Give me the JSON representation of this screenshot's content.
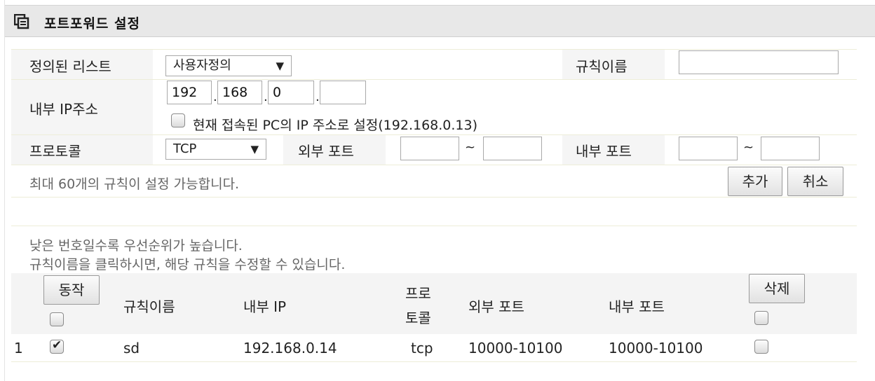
{
  "header": {
    "title": "포트포워드 설정"
  },
  "form": {
    "predefined_label": "정의된 리스트",
    "predefined_value": "사용자정의",
    "rule_name_label": "규칙이름",
    "rule_name_value": "",
    "internal_ip_label": "내부 IP주소",
    "ip_octets": [
      "192",
      "168",
      "0",
      ""
    ],
    "current_pc_checkbox_label": "현재 접속된 PC의 IP 주소로 설정(192.168.0.13)",
    "protocol_label": "프로토콜",
    "protocol_value": "TCP",
    "external_port_label": "외부 포트",
    "internal_port_label": "내부 포트",
    "range_sep": "~",
    "max_rules_note": "최대 60개의 규칙이 설정 가능합니다.",
    "add_button": "추가",
    "cancel_button": "취소"
  },
  "notes": {
    "line1": "낮은 번호일수록 우선순위가 높습니다.",
    "line2": "규칙이름을 클릭하시면, 해당 규칙을 수정할 수 있습니다."
  },
  "table": {
    "action_button": "동작",
    "col_rule_name": "규칙이름",
    "col_internal_ip": "내부 IP",
    "col_protocol_line1": "프로",
    "col_protocol_line2": "토콜",
    "col_external_port": "외부 포트",
    "col_internal_port": "내부 포트",
    "delete_button": "삭제",
    "rows": [
      {
        "num": "1",
        "active": true,
        "name": "sd",
        "ip": "192.168.0.14",
        "protocol": "tcp",
        "ext_port": "10000-10100",
        "int_port": "10000-10100",
        "delete": false
      }
    ]
  }
}
